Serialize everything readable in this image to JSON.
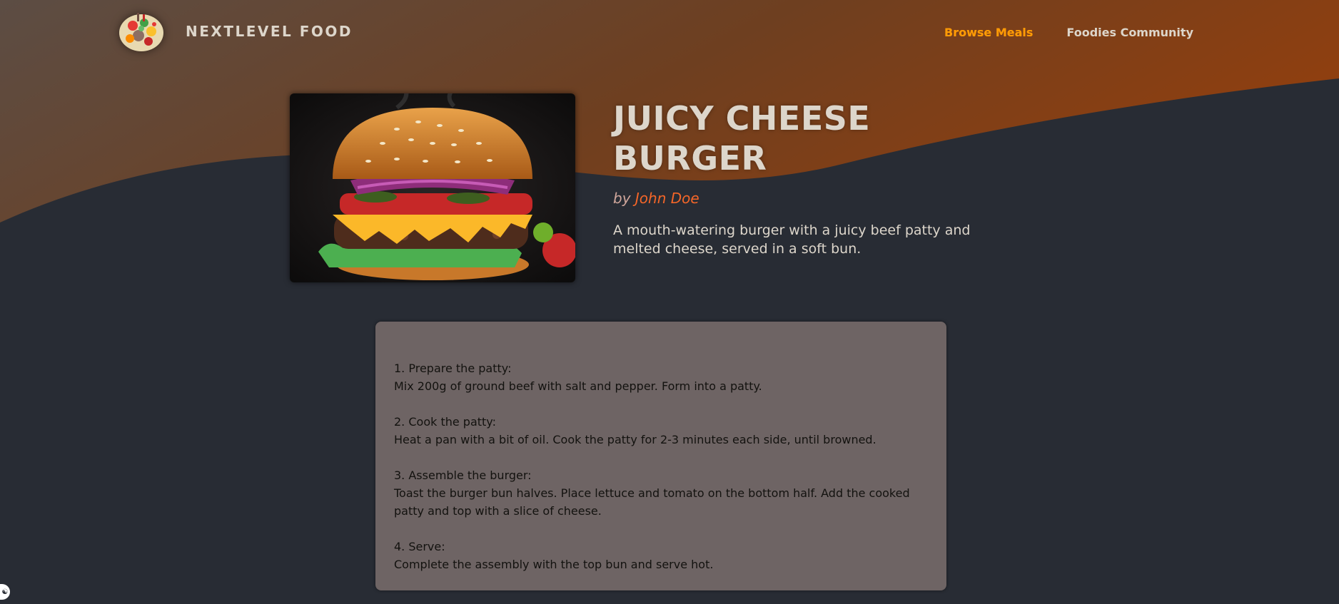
{
  "header": {
    "brand": "NEXTLEVEL FOOD",
    "logo_icon": "food-plate-logo-icon",
    "nav": [
      {
        "label": "Browse Meals",
        "active": true
      },
      {
        "label": "Foodies Community",
        "active": false
      }
    ]
  },
  "meal": {
    "title": "JUICY CHEESE BURGER",
    "by_prefix": "by",
    "creator": "John Doe",
    "summary": "A mouth-watering burger with a juicy beef patty and melted cheese, served in a soft bun.",
    "image_icon": "burger-photo"
  },
  "instructions": [
    {
      "title": "1. Prepare the patty:",
      "body": "Mix 200g of ground beef with salt and pepper. Form into a patty."
    },
    {
      "title": "2. Cook the patty:",
      "body": "Heat a pan with a bit of oil. Cook the patty for 2-3 minutes each side, until browned."
    },
    {
      "title": "3. Assemble the burger:",
      "body": "Toast the burger bun halves. Place lettuce and tomato on the bottom half. Add the cooked patty and top with a slice of cheese."
    },
    {
      "title": "4. Serve:",
      "body": "Complete the assembly with the top bun and serve hot."
    }
  ],
  "colors": {
    "background": "#282c34",
    "header_gradient_start": "#5a4a42",
    "header_gradient_end": "#8d3f0f",
    "accent_nav": "#ff9b05",
    "creator_link": "#f56628",
    "text": "#ddd6cb",
    "instructions_bg": "#6e6464"
  },
  "accessibility_icon": "accessibility-icon"
}
